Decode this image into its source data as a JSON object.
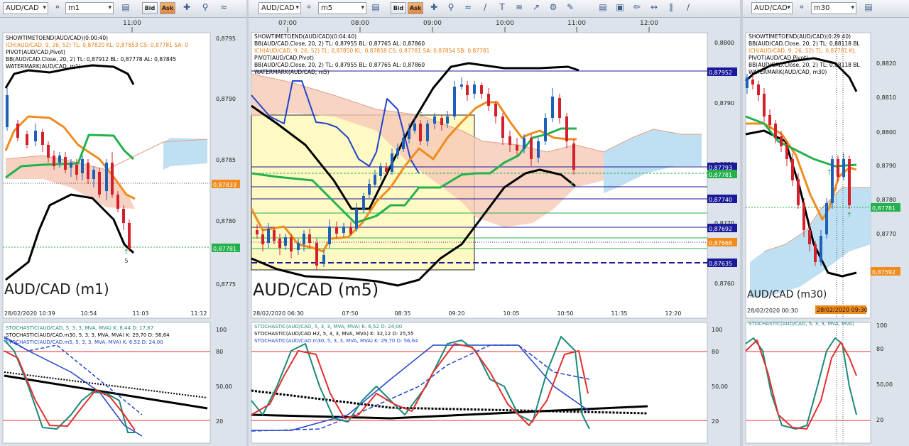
{
  "windows": [
    {
      "id": "w1",
      "symbol": "AUD/CAD",
      "timeframe": "m1",
      "watermark": "AUD/CAD (m1)",
      "top_time_label": "11:00",
      "indicators": [
        {
          "text": "SHOWTIMETOEND(AUD/CAD)(0:00:40)",
          "color": "#000000"
        },
        {
          "text": "ICH(AUD/CAD, 9, 26, 52)  TL: 0,87820  KL: 0,87853  CS: 0,87781  SA: 0",
          "color": "#e8801a"
        },
        {
          "text": "PIVOT(AUD/CAD,Pivot)",
          "color": "#000000"
        },
        {
          "text": "BB(AUD/CAD.Close, 20, 2)  TL: 0,87912  BL: 0,87778  AL: 0,87845",
          "color": "#000000"
        },
        {
          "text": "WATERMARK(AUD/CAD, m1)",
          "color": "#000000"
        }
      ],
      "price_axis": [
        "0,8795",
        "0,8790",
        "0,8785",
        "0,8780",
        "0,8775"
      ],
      "price_tags": [
        {
          "text": "0,87833",
          "color": "#f08c1e"
        },
        {
          "text": "0,87781",
          "color": "#22b14c"
        }
      ],
      "time_axis": [
        "28/02/2020 10:39",
        "10:54",
        "11:03",
        "11:12"
      ],
      "stoch_labels": [
        {
          "text": "STOCHASTIC(AUD/CAD, 5, 3, 3, MVA, MVA)  K: 8,44  D: 17,67",
          "color": "#1a8a7a"
        },
        {
          "text": "STOCHASTIC(AUD/CAD.m30, 5, 3, 3, MVA, MVA)  K: 29,70  D: 56,64",
          "color": "#000000"
        },
        {
          "text": "STOCHASTIC(AUD/CAD.m5, 5, 3, 3, MVA, MVA)  K: 6,52  D: 24,00",
          "color": "#2244cc"
        }
      ],
      "stoch_axis": [
        "100",
        "80",
        "50,00",
        "20"
      ]
    },
    {
      "id": "w2",
      "symbol": "AUD/CAD",
      "timeframe": "m5",
      "watermark": "AUD/CAD (m5)",
      "top_time_labels": [
        "07:00",
        "08:00",
        "09:00",
        "10:00",
        "11:00",
        "12:00"
      ],
      "indicators": [
        {
          "text": "SHOWTIMETOEND(AUD/CAD)(0:04:40)",
          "color": "#000000"
        },
        {
          "text": "BB(AUD/CAD.Close, 20, 2)  TL: 0,87955  BL: 0,87765  AL: 0,87860",
          "color": "#000000"
        },
        {
          "text": "ICH(AUD/CAD, 9, 26, 52)  TL: 0,87850  KL: 0,87858  CS: 0,87781  SA: 0,87854  SB: 0,87781",
          "color": "#e8801a"
        },
        {
          "text": "PIVOT(AUD/CAD,Pivot)",
          "color": "#000000"
        },
        {
          "text": "BB(AUD/CAD.Close, 20, 2)  TL: 0,87955  BL: 0,87765  AL: 0,87860",
          "color": "#000000"
        },
        {
          "text": "WATERMARK(AUD/CAD, m5)",
          "color": "#000000"
        }
      ],
      "price_axis": [
        "0,8800",
        "0,8790",
        "0,8780",
        "0,8770",
        "0,8760"
      ],
      "price_tags": [
        {
          "text": "0,87952",
          "color": "#1a1a9a"
        },
        {
          "text": "0,87793",
          "color": "#1a1a9a"
        },
        {
          "text": "0,87781",
          "color": "#22b14c"
        },
        {
          "text": "0,87740",
          "color": "#1a1a9a"
        },
        {
          "text": "0,87692",
          "color": "#1a1a9a"
        },
        {
          "text": "0,87668",
          "color": "#f08c1e"
        },
        {
          "text": "0,87635",
          "color": "#1a1a9a"
        }
      ],
      "time_axis": [
        "28/02/2020 06:30",
        "07:50",
        "08:35",
        "09:20",
        "10:05",
        "10:50",
        "11:35",
        "12:20"
      ],
      "stoch_labels": [
        {
          "text": "STOCHASTIC(AUD/CAD, 5, 3, 3, MVA, MVA)  K: 6,52  D: 24,00",
          "color": "#1a8a7a"
        },
        {
          "text": "STOCHASTIC(AUD/CAD.H2, 5, 3, 3, MVA, MVA)  K: 32,12  D: 25,55",
          "color": "#000000"
        },
        {
          "text": "STOCHASTIC(AUD/CAD.m30, 5, 3, 3, MVA, MVA)  K: 29,70  D: 56,64",
          "color": "#2244cc"
        }
      ],
      "stoch_axis": [
        "100",
        "80",
        "50,00",
        "20"
      ]
    },
    {
      "id": "w3",
      "symbol": "AUD/CAD",
      "timeframe": "m30",
      "watermark": "AUD/CAD (m30)",
      "indicators": [
        {
          "text": "SHOWTIMETOEND(AUD/CAD)(0:29:40)",
          "color": "#000000"
        },
        {
          "text": "BB(AUD/CAD.Close, 20, 2)  TL: 0,88118  BL",
          "color": "#000000"
        },
        {
          "text": "ICH(AUD/CAD, 9, 26, 52)  TL: 0,87781  KL",
          "color": "#e8801a"
        },
        {
          "text": "PIVOT(AUD/CAD,Pivot)",
          "color": "#000000"
        },
        {
          "text": "BB(AUD/CAD.Close, 20, 2)  TL: 0,88118  BL",
          "color": "#000000"
        },
        {
          "text": "WATERMARK(AUD/CAD, m30)",
          "color": "#000000"
        }
      ],
      "price_axis": [
        "0,8820",
        "0,8810",
        "0,8800",
        "0,8790",
        "0,8780",
        "0,8770"
      ],
      "price_tags": [
        {
          "text": "0,87781",
          "color": "#22b14c"
        },
        {
          "text": "0,87592",
          "color": "#f08c1e"
        }
      ],
      "time_axis": [
        "28/02/2020 00:30",
        "28/02/2020 09:30"
      ],
      "stoch_labels": [
        {
          "text": "STOCHASTIC(AUD/CAD, 5, 3, 3, MVA, MVA)",
          "color": "#1a8a7a"
        }
      ],
      "stoch_axis": [
        "100",
        "80",
        "50,00",
        "20"
      ]
    }
  ],
  "toolbar": {
    "bid_label": "Bid",
    "ask_label": "Ask",
    "icons": [
      "chart-type-icon",
      "crosshair-icon",
      "zoom-icon",
      "indicator-icon",
      "drawing-icon"
    ]
  }
}
